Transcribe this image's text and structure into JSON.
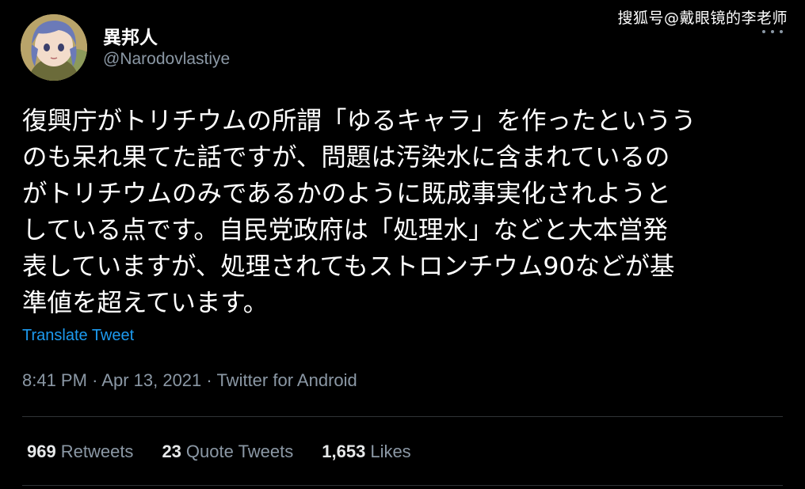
{
  "watermark": "搜狐号@戴眼镜的李老师",
  "user": {
    "name": "異邦人",
    "handle": "@Narodovlastiye"
  },
  "tweet": {
    "lines": [
      "復興庁がトリチウムの所謂「ゆるキャラ」を作ったというう",
      "のも呆れ果てた話ですが、問題は汚染水に含まれているの",
      "がトリチウムのみであるかのように既成事実化されようと",
      "している点です。自民党政府は「処理水」などと大本営発",
      "表していますが、処理されてもストロンチウム90などが基",
      "準値を超えています。"
    ],
    "translate_label": "Translate Tweet",
    "time": "8:41 PM",
    "date": "Apr 13, 2021",
    "source": "Twitter for Android",
    "separator": "·"
  },
  "stats": {
    "retweets": {
      "count": "969",
      "label": "Retweets"
    },
    "quotes": {
      "count": "23",
      "label": "Quote Tweets"
    },
    "likes": {
      "count": "1,653",
      "label": "Likes"
    }
  },
  "colors": {
    "background": "#000000",
    "text": "#ffffff",
    "secondary": "#8b98a5",
    "link": "#1d9bf0",
    "divider": "#2f3336"
  },
  "icons": {
    "more": "more-dots-icon"
  }
}
